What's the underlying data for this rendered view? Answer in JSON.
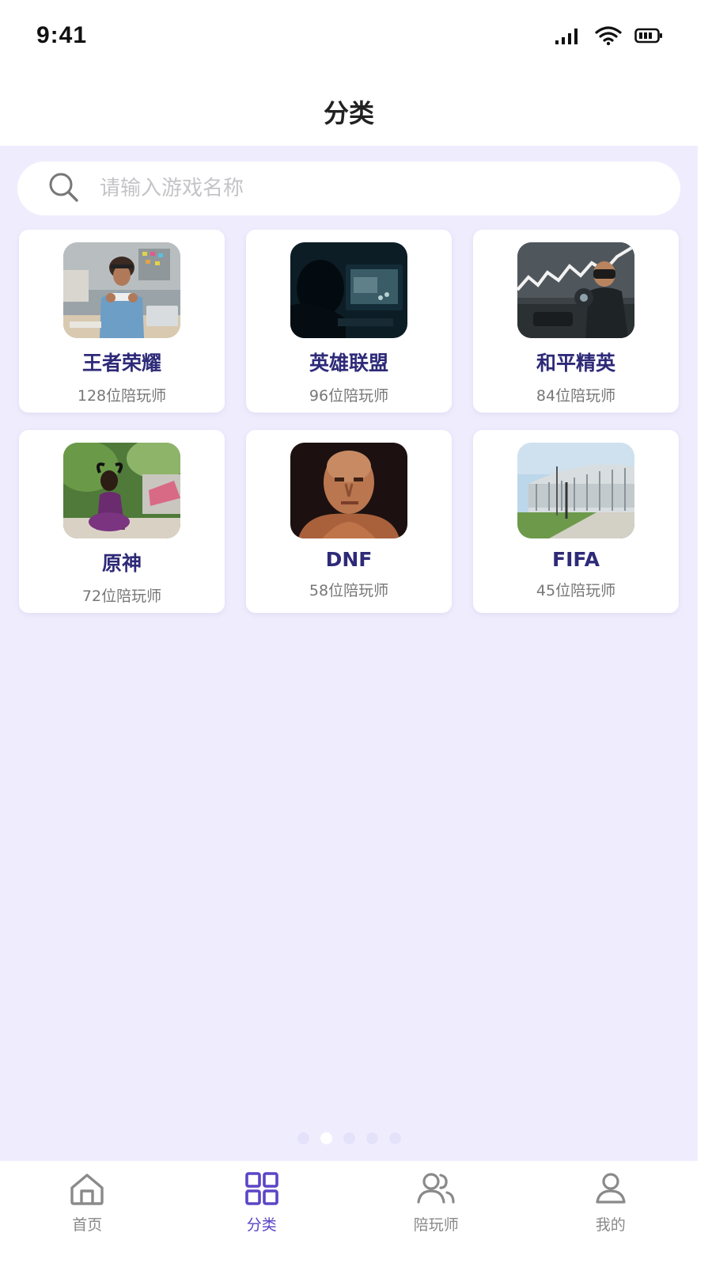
{
  "status": {
    "time": "9:41"
  },
  "header": {
    "title": "分类"
  },
  "search": {
    "placeholder": "请输入游戏名称"
  },
  "games": [
    {
      "name": "王者荣耀",
      "count": "128位陪玩师",
      "icon": "person-playing-phone-photo"
    },
    {
      "name": "英雄联盟",
      "count": "96位陪玩师",
      "icon": "gamer-at-monitor-photo"
    },
    {
      "name": "和平精英",
      "count": "84位陪玩师",
      "icon": "vr-gamer-photo"
    },
    {
      "name": "原神",
      "count": "72位陪玩师",
      "icon": "cosplay-girl-photo"
    },
    {
      "name": "DNF",
      "count": "58位陪玩师",
      "icon": "bald-character-photo"
    },
    {
      "name": "FIFA",
      "count": "45位陪玩师",
      "icon": "stadium-photo"
    }
  ],
  "tabs": [
    {
      "label": "首页",
      "icon": "home-icon"
    },
    {
      "label": "分类",
      "icon": "grid-icon",
      "active": true
    },
    {
      "label": "陪玩师",
      "icon": "users-icon"
    },
    {
      "label": "我的",
      "icon": "user-icon"
    }
  ],
  "colors": {
    "accent": "#5b45c6",
    "card_title": "#2e2a78",
    "background": "#efedfd"
  },
  "pager": {
    "count": 5,
    "active_index": 1
  }
}
